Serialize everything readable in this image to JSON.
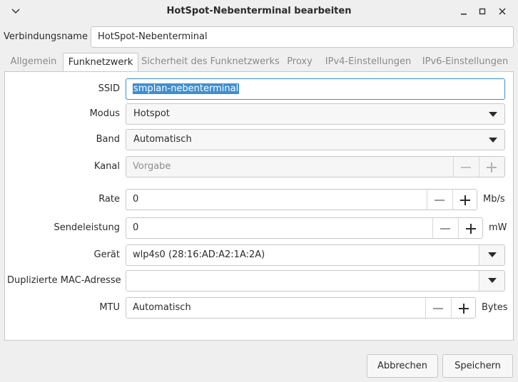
{
  "window": {
    "title": "HotSpot-Nebenterminal bearbeiten",
    "menu_icon": "chevron-down-icon",
    "minimize_icon": "minimize-icon",
    "maximize_icon": "maximize-icon",
    "close_icon": "close-icon"
  },
  "connection": {
    "name_label": "Verbindungsname",
    "name_value": "HotSpot-Nebenterminal"
  },
  "tabs": [
    {
      "label": "Allgemein",
      "active": false
    },
    {
      "label": "Funknetzwerk",
      "active": true
    },
    {
      "label": "Sicherheit des Funknetzwerks",
      "active": false
    },
    {
      "label": "Proxy",
      "active": false
    },
    {
      "label": "IPv4-Einstellungen",
      "active": false
    },
    {
      "label": "IPv6-Einstellungen",
      "active": false
    }
  ],
  "form": {
    "ssid": {
      "label": "SSID",
      "value": "smplan-nebenterminal"
    },
    "modus": {
      "label": "Modus",
      "value": "Hotspot"
    },
    "band": {
      "label": "Band",
      "value": "Automatisch"
    },
    "kanal": {
      "label": "Kanal",
      "placeholder": "Vorgabe"
    },
    "rate": {
      "label": "Rate",
      "value": "0",
      "unit": "Mb/s"
    },
    "sendeleistung": {
      "label": "Sendeleistung",
      "value": "0",
      "unit": "mW"
    },
    "geraet": {
      "label": "Gerät",
      "value": "wlp4s0 (28:16:AD:A2:1A:2A)"
    },
    "dup_mac": {
      "label": "Duplizierte MAC-Adresse",
      "value": ""
    },
    "mtu": {
      "label": "MTU",
      "value": "Automatisch",
      "unit": "Bytes"
    }
  },
  "buttons": {
    "cancel": "Abbrechen",
    "save": "Speichern"
  },
  "colors": {
    "accent": "#3d8fd1",
    "background": "#efefef",
    "panel": "#ffffff"
  }
}
